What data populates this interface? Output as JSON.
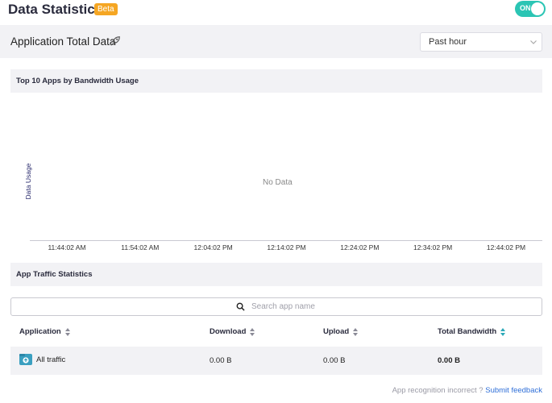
{
  "header": {
    "title": "Data Statistics",
    "beta_badge": "Beta",
    "toggle_label": "ON"
  },
  "app_bar": {
    "title": "Application Total Data",
    "time_range": "Past hour"
  },
  "top10_section": {
    "title": "Top 10 Apps by Bandwidth Usage"
  },
  "chart_data": {
    "type": "line",
    "title": "Top 10 Apps by Bandwidth Usage",
    "ylabel": "Data Usage",
    "xlabel": "",
    "empty_message": "No Data",
    "x_ticks": [
      "11:44:02 AM",
      "11:54:02 AM",
      "12:04:02 PM",
      "12:14:02 PM",
      "12:24:02 PM",
      "12:34:02 PM",
      "12:44:02 PM"
    ],
    "series": [],
    "grid": false
  },
  "traffic_section": {
    "title": "App Traffic Statistics"
  },
  "search": {
    "placeholder": "Search app name",
    "value": ""
  },
  "table": {
    "columns": [
      "Application",
      "Download",
      "Upload",
      "Total Bandwidth"
    ],
    "rows": [
      {
        "application": "All traffic",
        "download": "0.00 B",
        "upload": "0.00 B",
        "total": "0.00 B"
      }
    ]
  },
  "footer": {
    "text": "App recognition incorrect ?",
    "link": "Submit feedback"
  },
  "colors": {
    "accent": "#2bc5b4",
    "beta": "#f5a623",
    "link": "#2f6fd8"
  }
}
